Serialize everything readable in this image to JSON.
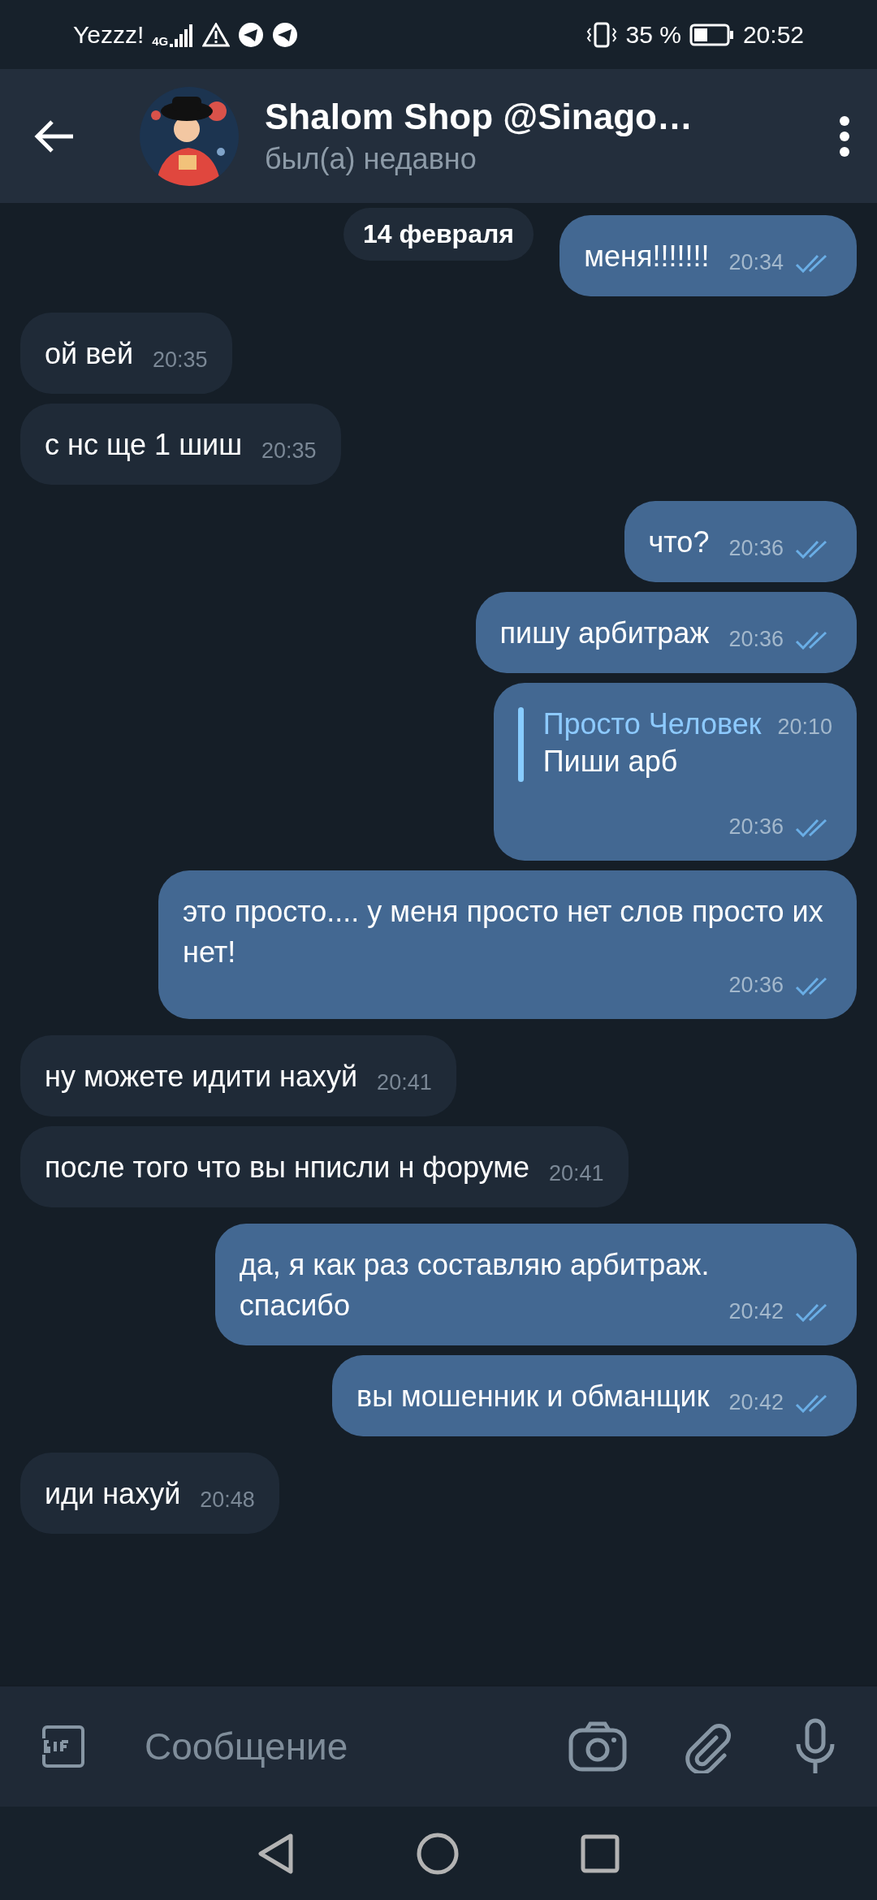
{
  "status_bar": {
    "carrier": "Yezzz!",
    "network": "4G",
    "battery": "35 %",
    "time": "20:52"
  },
  "header": {
    "title": "Shalom Shop @Sinago…",
    "subtitle": "был(а) недавно"
  },
  "date_pill": "14 февраля",
  "messages": [
    {
      "kind": "outgoing",
      "text": "меня!!!!!!!",
      "time": "20:34",
      "read": true
    },
    {
      "kind": "incoming",
      "text": "ой вей",
      "time": "20:35"
    },
    {
      "kind": "incoming",
      "text": "с нс ще 1 шиш",
      "time": "20:35"
    },
    {
      "kind": "outgoing",
      "text": "что?",
      "time": "20:36",
      "read": true
    },
    {
      "kind": "outgoing",
      "text": "пишу арбитраж",
      "time": "20:36",
      "read": true
    },
    {
      "kind": "outgoing",
      "reply": {
        "name": "Просто Человек",
        "time": "20:10",
        "text": "Пиши арб"
      },
      "time": "20:36",
      "read": true
    },
    {
      "kind": "outgoing",
      "text": "это просто.... у меня просто нет слов просто их нет!",
      "time": "20:36",
      "read": true
    },
    {
      "kind": "incoming",
      "text": "ну можете идити нахуй",
      "time": "20:41"
    },
    {
      "kind": "incoming",
      "text": "после того что вы нписли н форуме",
      "time": "20:41"
    },
    {
      "kind": "outgoing",
      "text": "да, я как раз составляю арбитраж.\nспасибо",
      "time": "20:42",
      "read": true
    },
    {
      "kind": "outgoing",
      "text": "вы мошенник и обманщик",
      "time": "20:42",
      "read": true
    },
    {
      "kind": "incoming",
      "text": "иди нахуй",
      "time": "20:48"
    }
  ],
  "composer": {
    "placeholder": "Сообщение"
  }
}
